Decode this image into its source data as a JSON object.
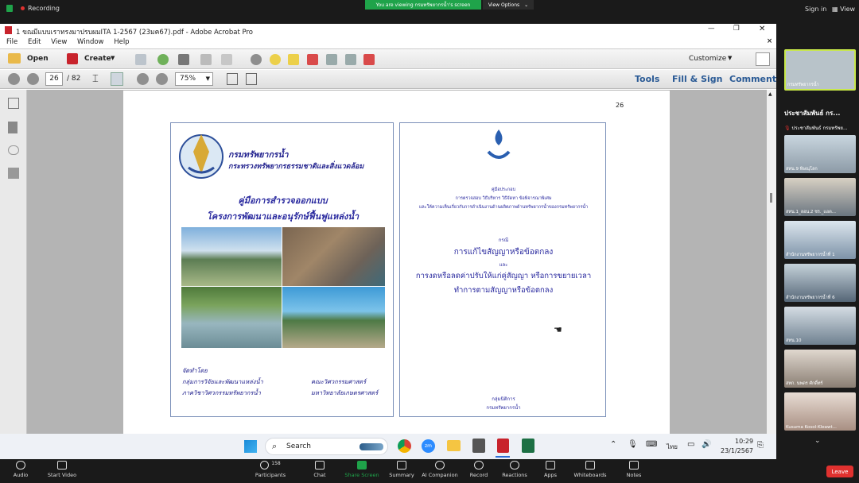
{
  "zoom": {
    "recording": "Recording",
    "viewing_banner": "You are viewing กรมทรัพยากรน้ำ's screen",
    "view_options": "View Options",
    "sign_in": "Sign in",
    "view": "View",
    "leave": "Leave",
    "participants_count": "158",
    "toolbar": [
      "Audio",
      "Start Video",
      "Participants",
      "Chat",
      "Share Screen",
      "Summary",
      "AI Companion",
      "Record",
      "Reactions",
      "Apps",
      "Whiteboards",
      "Notes"
    ],
    "gallery_header": "ประชาสัมพันธ์ กร...",
    "self_name": "กรมทรัพยากรน้ำ",
    "gallery": [
      "ประชาสัมพันธ์ กรมทรัพย...",
      "สทน.9 พิษณุโลก",
      "สทน.1_ลอน.2 ชร._แอด...",
      "สำนักงานทรัพยากรน้ำที่ 1",
      "สำนักงานทรัพยากรน้ำที่ 6",
      "สทน.10",
      "สทก. นพดร ศักดิ์ทร์",
      "Kusuma Kosol-Kleawt..."
    ]
  },
  "acrobat": {
    "title": "1 ขณมีแบบเราทรงมาปรบผมITA 1-2567 (23มค67).pdf - Adobe Acrobat Pro",
    "menu": [
      "File",
      "Edit",
      "View",
      "Window",
      "Help"
    ],
    "open": "Open",
    "create": "Create",
    "customize": "Customize",
    "page_current": "26",
    "page_total": "/ 82",
    "zoom_level": "75%",
    "tools": "Tools",
    "fill_sign": "Fill & Sign",
    "comment": "Comment"
  },
  "document": {
    "page_number": "26",
    "left": {
      "org1": "กรมทรัพยากรน้ำ",
      "org2": "กระทรวงทรัพยากรธรรมชาติและสิ่งแวดล้อม",
      "title1": "คู่มือการสำรวจออกแบบ",
      "title2": "โครงการพัฒนาและอนุรักษ์ฟื้นฟูแหล่งน้ำ",
      "by": "จัดทำโดย",
      "by1": "กลุ่มการวิจัยและพัฒนาแหล่งน้ำ",
      "by2": "ภาควิชาวิศวกรรมทรัพยากรน้ำ",
      "fac1": "คณะวิศวกรรมศาสตร์",
      "fac2": "มหาวิทยาลัยเกษตรศาสตร์"
    },
    "right": {
      "small1": "คู่มือประกอบ",
      "small2": "การตรวจสอบ วิธีบริหาร วิธีจัดหา ข้อพิจารณาพิเศษ",
      "small3": "และให้ความเห็นเกี่ยวกับการดำเนินงานด้านผลิตภาพด้านทรัพยากรน้ำของกรมทรัพยากรน้ำ",
      "case": "กรณี",
      "t1": "การแก้ไขสัญญาหรือข้อตกลง",
      "and": "และ",
      "t2": "การงดหรือลดค่าปรับให้แก่คู่สัญญา หรือการขยายเวลา",
      "t3": "ทำการตามสัญญาหรือข้อตกลง",
      "foot1": "กลุ่มนิติการ",
      "foot2": "กรมทรัพยากรน้ำ"
    }
  },
  "taskbar": {
    "search": "Search",
    "lang": "ไทย",
    "time": "10:29",
    "date": "23/1/2567"
  },
  "colors": {
    "zoom_green": "#1fa34a",
    "leave_red": "#e0312f",
    "acrobat_blue": "#2a5a95"
  }
}
